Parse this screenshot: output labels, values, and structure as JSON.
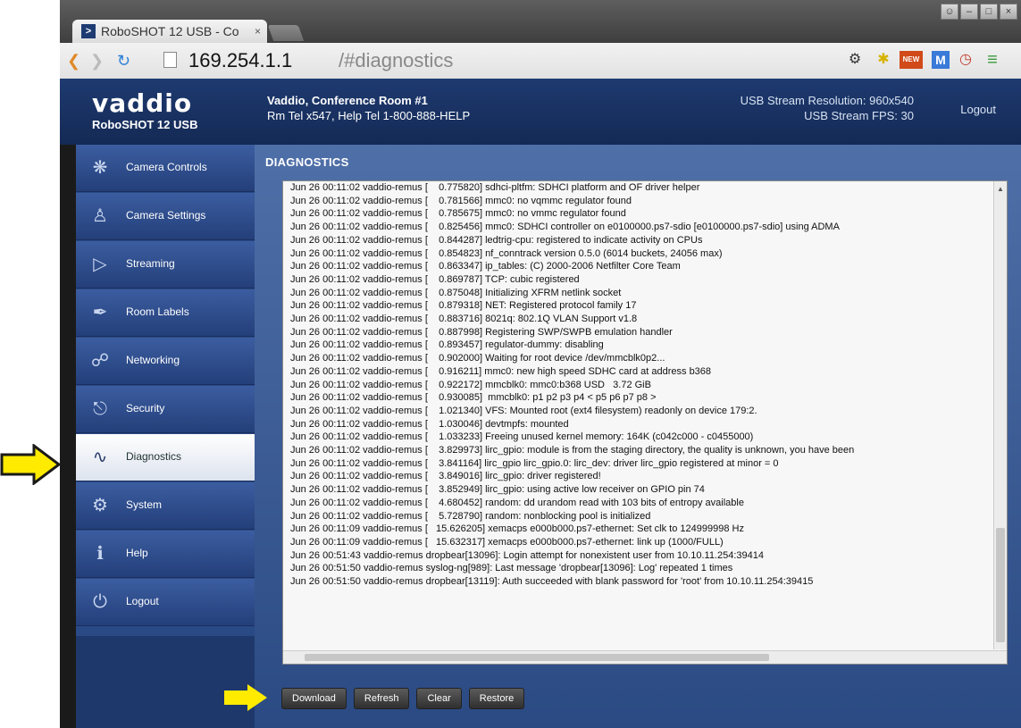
{
  "browser": {
    "tab_title": "RoboSHOT 12 USB - Co",
    "tab_close": "×",
    "url_host": "169.254.1.1",
    "url_path": "/#diagnostics",
    "new_badge": "NEW",
    "ext_m": "M"
  },
  "header": {
    "brand": "vaddio",
    "model": "RoboSHOT 12 USB",
    "room_name": "Vaddio, Conference Room #1",
    "room_phone": "Rm Tel x547, Help Tel 1-800-888-HELP",
    "stream_resolution": "USB Stream Resolution: 960x540",
    "stream_fps": "USB Stream FPS: 30",
    "logout": "Logout"
  },
  "sidebar": {
    "items": [
      {
        "label": "Camera Controls",
        "icon": "camera-controls-icon"
      },
      {
        "label": "Camera Settings",
        "icon": "camera-settings-icon"
      },
      {
        "label": "Streaming",
        "icon": "streaming-icon"
      },
      {
        "label": "Room Labels",
        "icon": "room-labels-icon"
      },
      {
        "label": "Networking",
        "icon": "networking-icon"
      },
      {
        "label": "Security",
        "icon": "security-icon"
      },
      {
        "label": "Diagnostics",
        "icon": "diagnostics-icon",
        "active": true
      },
      {
        "label": "System",
        "icon": "system-icon"
      },
      {
        "label": "Help",
        "icon": "help-icon"
      },
      {
        "label": "Logout",
        "icon": "logout-icon"
      }
    ]
  },
  "main": {
    "title": "DIAGNOSTICS",
    "log_lines": [
      "Jun 26 00:11:02 vaddio-remus [    0.775820] sdhci-pltfm: SDHCI platform and OF driver helper",
      "Jun 26 00:11:02 vaddio-remus [    0.781566] mmc0: no vqmmc regulator found",
      "Jun 26 00:11:02 vaddio-remus [    0.785675] mmc0: no vmmc regulator found",
      "Jun 26 00:11:02 vaddio-remus [    0.825456] mmc0: SDHCI controller on e0100000.ps7-sdio [e0100000.ps7-sdio] using ADMA",
      "Jun 26 00:11:02 vaddio-remus [    0.844287] ledtrig-cpu: registered to indicate activity on CPUs",
      "Jun 26 00:11:02 vaddio-remus [    0.854823] nf_conntrack version 0.5.0 (6014 buckets, 24056 max)",
      "Jun 26 00:11:02 vaddio-remus [    0.863347] ip_tables: (C) 2000-2006 Netfilter Core Team",
      "Jun 26 00:11:02 vaddio-remus [    0.869787] TCP: cubic registered",
      "Jun 26 00:11:02 vaddio-remus [    0.875048] Initializing XFRM netlink socket",
      "Jun 26 00:11:02 vaddio-remus [    0.879318] NET: Registered protocol family 17",
      "Jun 26 00:11:02 vaddio-remus [    0.883716] 8021q: 802.1Q VLAN Support v1.8",
      "Jun 26 00:11:02 vaddio-remus [    0.887998] Registering SWP/SWPB emulation handler",
      "Jun 26 00:11:02 vaddio-remus [    0.893457] regulator-dummy: disabling",
      "Jun 26 00:11:02 vaddio-remus [    0.902000] Waiting for root device /dev/mmcblk0p2...",
      "Jun 26 00:11:02 vaddio-remus [    0.916211] mmc0: new high speed SDHC card at address b368",
      "Jun 26 00:11:02 vaddio-remus [    0.922172] mmcblk0: mmc0:b368 USD   3.72 GiB",
      "Jun 26 00:11:02 vaddio-remus [    0.930085]  mmcblk0: p1 p2 p3 p4 < p5 p6 p7 p8 >",
      "Jun 26 00:11:02 vaddio-remus [    1.021340] VFS: Mounted root (ext4 filesystem) readonly on device 179:2.",
      "Jun 26 00:11:02 vaddio-remus [    1.030046] devtmpfs: mounted",
      "Jun 26 00:11:02 vaddio-remus [    1.033233] Freeing unused kernel memory: 164K (c042c000 - c0455000)",
      "Jun 26 00:11:02 vaddio-remus [    3.829973] lirc_gpio: module is from the staging directory, the quality is unknown, you have been",
      "Jun 26 00:11:02 vaddio-remus [    3.841164] lirc_gpio lirc_gpio.0: lirc_dev: driver lirc_gpio registered at minor = 0",
      "Jun 26 00:11:02 vaddio-remus [    3.849016] lirc_gpio: driver registered!",
      "Jun 26 00:11:02 vaddio-remus [    3.852949] lirc_gpio: using active low receiver on GPIO pin 74",
      "Jun 26 00:11:02 vaddio-remus [    4.680452] random: dd urandom read with 103 bits of entropy available",
      "Jun 26 00:11:02 vaddio-remus [    5.728790] random: nonblocking pool is initialized",
      "Jun 26 00:11:09 vaddio-remus [   15.626205] xemacps e000b000.ps7-ethernet: Set clk to 124999998 Hz",
      "Jun 26 00:11:09 vaddio-remus [   15.632317] xemacps e000b000.ps7-ethernet: link up (1000/FULL)",
      "Jun 26 00:51:43 vaddio-remus dropbear[13096]: Login attempt for nonexistent user from 10.10.11.254:39414",
      "Jun 26 00:51:50 vaddio-remus syslog-ng[989]: Last message 'dropbear[13096]: Log' repeated 1 times",
      "Jun 26 00:51:50 vaddio-remus dropbear[13119]: Auth succeeded with blank password for 'root' from 10.10.11.254:39415"
    ],
    "buttons": {
      "download": "Download",
      "refresh": "Refresh",
      "clear": "Clear",
      "restore": "Restore"
    }
  },
  "colors": {
    "header_bg": "#1e3a70",
    "sidebar_bg": "#2a4a86",
    "arrow_fill": "#ffeb00"
  }
}
